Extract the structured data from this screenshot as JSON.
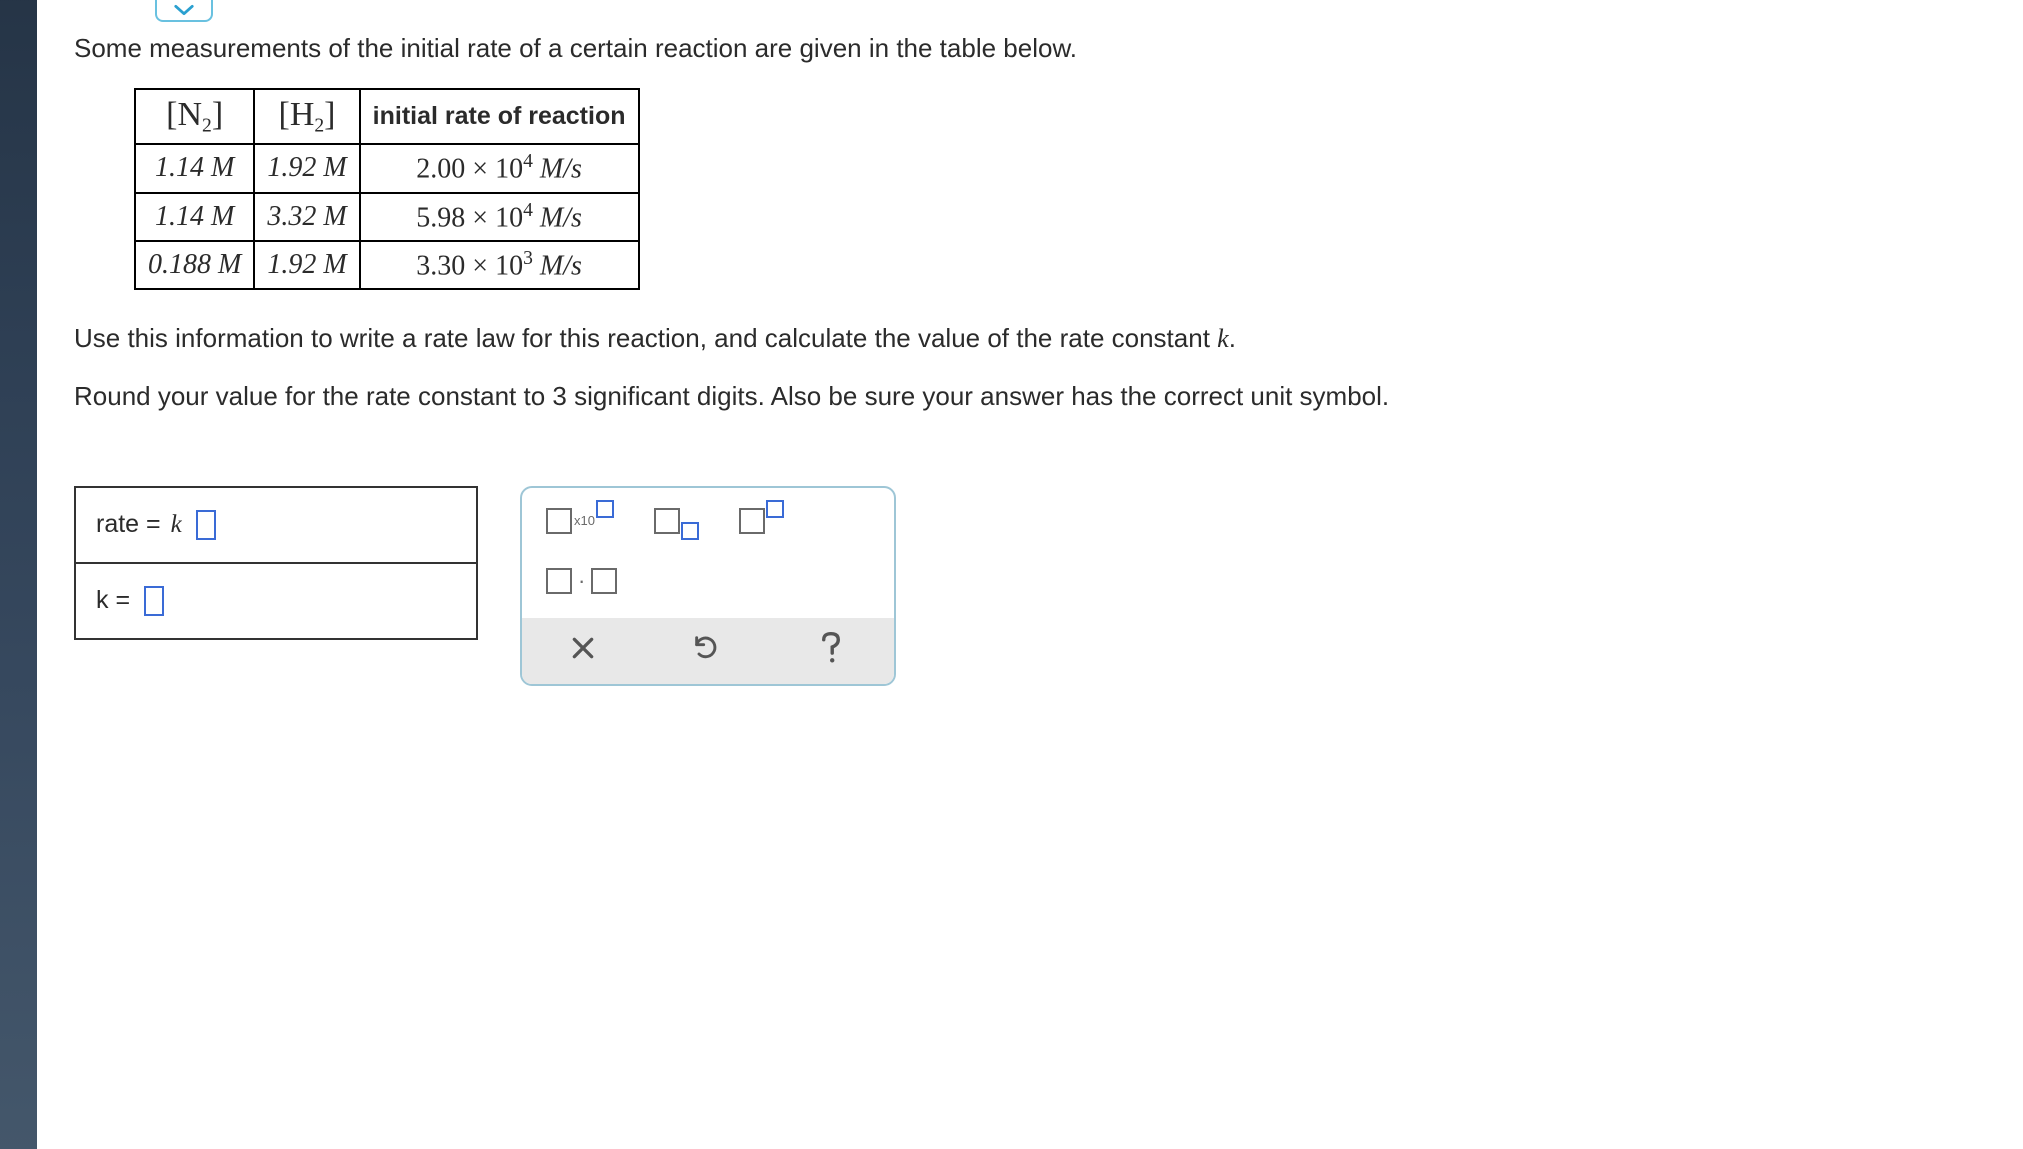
{
  "intro": "Some measurements of the initial rate of a certain reaction are given in the table below.",
  "table": {
    "headers": {
      "col1_species": "N",
      "col1_sub": "2",
      "col2_species": "H",
      "col2_sub": "2",
      "col3": "initial rate of reaction"
    },
    "rows": [
      {
        "n2": "1.14 M",
        "h2": "1.92 M",
        "rate_mant": "2.00 × 10",
        "rate_exp": "4",
        "rate_unit": " M/s"
      },
      {
        "n2": "1.14 M",
        "h2": "3.32 M",
        "rate_mant": "5.98 × 10",
        "rate_exp": "4",
        "rate_unit": " M/s"
      },
      {
        "n2": "0.188 M",
        "h2": "1.92 M",
        "rate_mant": "3.30 × 10",
        "rate_exp": "3",
        "rate_unit": " M/s"
      }
    ]
  },
  "instruction1_a": "Use this information to write a rate law for this reaction, and calculate the value of the rate constant ",
  "instruction1_b": ".",
  "rate_constant_symbol": "k",
  "instruction2": "Round your value for the rate constant to 3 significant digits. Also be sure your answer has the correct unit symbol.",
  "answer": {
    "row1_label": "rate  =",
    "row1_sym": "k",
    "row2_label": "k  ="
  },
  "palette": {
    "sci_label": "x10",
    "dot": "·"
  }
}
